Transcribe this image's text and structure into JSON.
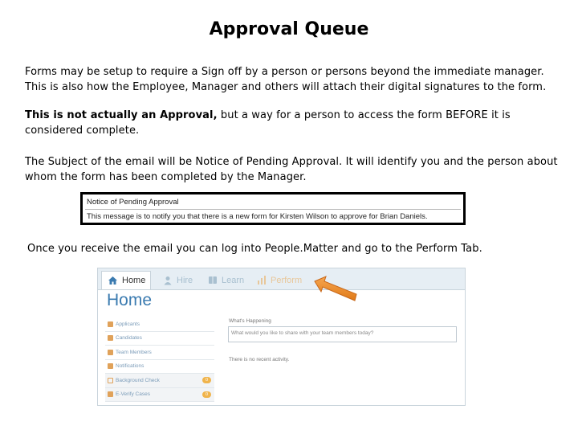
{
  "title": "Approval Queue",
  "paragraphs": {
    "p1": "Forms may be setup to require a Sign off by a person or persons beyond the immediate manager. This is also how the Employee, Manager and others will attach their digital signatures to the form.",
    "p2_bold": "This is not actually an Approval,",
    "p2_rest": " but a way for a person to access the form BEFORE it is considered complete.",
    "p3": "The Subject of the email will be Notice of Pending Approval.  It will identify you and the person about whom the form has been completed by the Manager.",
    "p4": "Once you receive the email you can log into People.Matter and go to the Perform Tab."
  },
  "email": {
    "subject": "Notice of Pending Approval",
    "body": "This message is to notify you that there is a new form for Kirsten Wilson to approve for Brian Daniels."
  },
  "app": {
    "tabs": [
      {
        "label": "Home",
        "icon": "home-icon"
      },
      {
        "label": "Hire",
        "icon": "person-icon"
      },
      {
        "label": "Learn",
        "icon": "book-icon"
      },
      {
        "label": "Perform",
        "icon": "bar-chart-icon"
      }
    ],
    "page_title": "Home",
    "sidebar": [
      {
        "label": "Applicants",
        "badge": ""
      },
      {
        "label": "Candidates",
        "badge": ""
      },
      {
        "label": "Team Members",
        "badge": ""
      },
      {
        "label": "Notifications",
        "badge": ""
      },
      {
        "label": "Background Check",
        "badge": "0"
      },
      {
        "label": "E-Verify Cases",
        "badge": "0"
      }
    ],
    "whats_happening_label": "What's Happening",
    "whats_happening_placeholder": "What would you like to share with your team members today?",
    "no_activity": "There is no recent activity."
  },
  "colors": {
    "accent_blue": "#3b7bb0",
    "arrow_orange": "#f08a24",
    "badge_orange": "#f0b44c"
  }
}
